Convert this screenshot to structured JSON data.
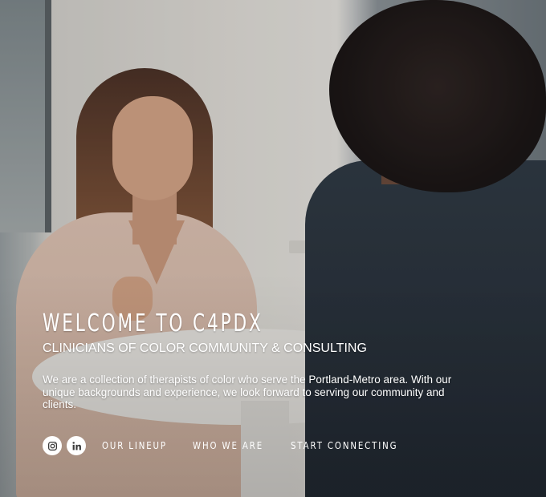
{
  "hero": {
    "title": "WELCOME TO C4PDX",
    "subtitle": "CLINICIANS OF COLOR COMMUNITY & CONSULTING",
    "description": "We are a collection of therapists of color who serve the Portland-Metro area. With our unique backgrounds and experience, we look forward to serving our community and clients."
  },
  "social": [
    {
      "icon": "instagram-icon"
    },
    {
      "icon": "linkedin-icon"
    }
  ],
  "nav": {
    "links": [
      {
        "label": "OUR LINEUP"
      },
      {
        "label": "WHO WE ARE"
      },
      {
        "label": "START CONNECTING"
      }
    ]
  },
  "colors": {
    "text": "#ffffff",
    "icon_bg": "#ffffff",
    "icon_fg": "#3a3a3a"
  }
}
